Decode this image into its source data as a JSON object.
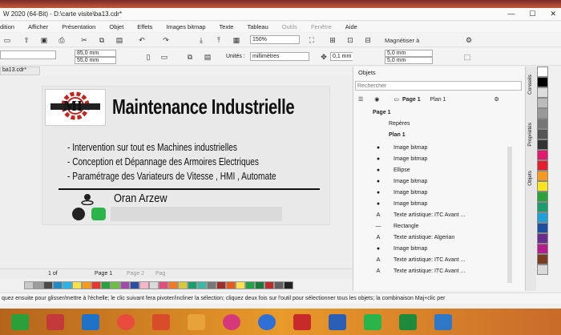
{
  "window": {
    "title": "W 2020 (64-Bit) - D:\\carte visite\\ba13.cdr*",
    "btn_min": "—",
    "btn_max": "☐",
    "btn_close": "✕"
  },
  "menu": [
    "dition",
    "Afficher",
    "Présentation",
    "Objet",
    "Effets",
    "Images bitmap",
    "Texte",
    "Tableau",
    "Outils",
    "Fenêtre",
    "Aide"
  ],
  "toolbar": {
    "zoom": "150%",
    "snap": "Magnétiser à",
    "width": "85,0 mm",
    "height": "55,0 mm",
    "units_label": "Unités :",
    "units": "millimètres",
    "nudge": "0,1 mm",
    "dup_x": "5,0 mm",
    "dup_y": "5,0 mm"
  },
  "doc_tab": "ba13.cdr*",
  "card": {
    "logo_text": "MI",
    "title": "Maintenance Industrielle",
    "bullets": [
      "- Intervention sur tout es Machines industrielles",
      "- Conception et Dépannage des Armoires Electriques",
      "- Paramétrage des Variateurs de Vitesse , HMI , Automate"
    ],
    "location": "Oran Arzew"
  },
  "pagebar": {
    "counter": "1 of",
    "page1": "Page 1",
    "page2": "Page 2",
    "page3": "Pag"
  },
  "objects_panel": {
    "title": "Objets",
    "search_placeholder": "Rechercher",
    "page_label": "Page 1",
    "plan_label": "Plan 1",
    "page_node": "Page 1",
    "reperes": "Repères",
    "plan_node": "Plan 1",
    "items": [
      "Image bitmap",
      "Image bitmap",
      "Ellipse",
      "Image bitmap",
      "Image bitmap",
      "Image bitmap",
      "Texte artistique: ITC Avant ...",
      "Rectangle",
      "Texte artistique: Algerian",
      "Image bitmap",
      "Texte artistique: ITC Avant ...",
      "Texte artistique: ITC Avant ..."
    ]
  },
  "side_tabs": [
    "Conseils",
    "Propriétés",
    "Objets"
  ],
  "status": "quez ensuite pour glisser/mettre à l'échelle; le clic suivant fera pivoter/incliner la sélection; cliquez deux fois sur l'outil pour sélectionner tous les objets; la combinaison Maj+clic per",
  "colors": {
    "palette": [
      "#c9c9c9",
      "#9c9c9c",
      "#4a4a4a",
      "#1f8cc7",
      "#2bb3e6",
      "#f4e24a",
      "#f39a1f",
      "#e6372e",
      "#2aa23a",
      "#6dbd45",
      "#a04da8",
      "#2c4fa3",
      "#f5b7c5",
      "#dadada",
      "#e0507a",
      "#f07a2a",
      "#d7c83d",
      "#1d9c6d",
      "#3cb8a5",
      "#777",
      "#9b2e2e",
      "#e55c20",
      "#fbe14f",
      "#26a045",
      "#1a7a3a",
      "#b92e2e",
      "#5f5f5f",
      "#222"
    ],
    "right_palette": [
      "#ffffff",
      "#000000",
      "#dddddd",
      "#bbbbbb",
      "#999999",
      "#777777",
      "#555555",
      "#333333",
      "#e3196f",
      "#e31e2e",
      "#f49a1f",
      "#f8e51f",
      "#2aa23a",
      "#1d9c6d",
      "#1fa0d8",
      "#1d4fa0",
      "#6a2c8f",
      "#b71c8c",
      "#7a3b1f",
      "#d9d9d9"
    ]
  }
}
